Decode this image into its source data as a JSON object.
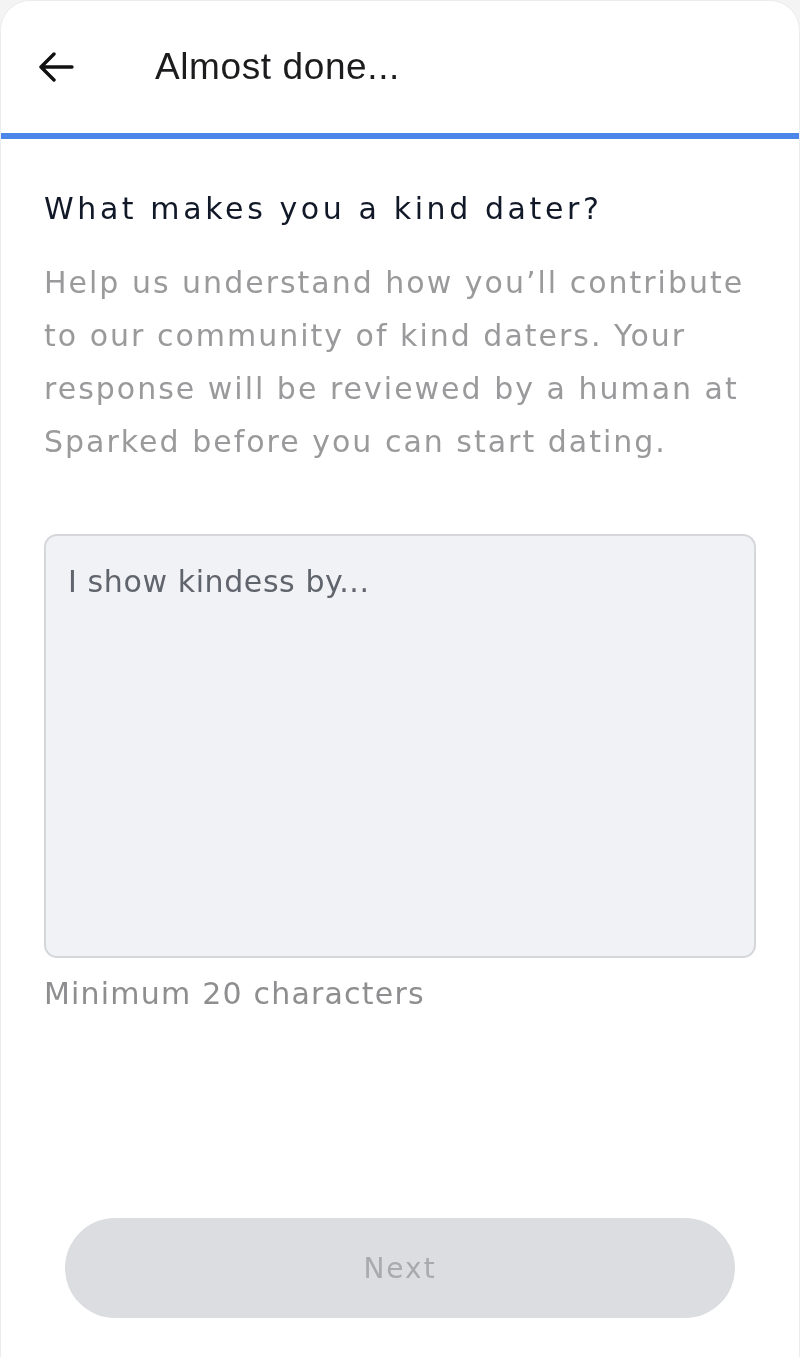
{
  "header": {
    "title": "Almost done..."
  },
  "question": {
    "heading": "What makes you a kind dater?",
    "description": "Help us understand how you’ll contribute to our community of kind daters. Your response will be reviewed by a human at Sparked before you can start dating."
  },
  "answer": {
    "placeholder": "I show kindess by...",
    "hint": "Minimum 20 characters"
  },
  "next_button": {
    "label": "Next",
    "disabled": true
  }
}
